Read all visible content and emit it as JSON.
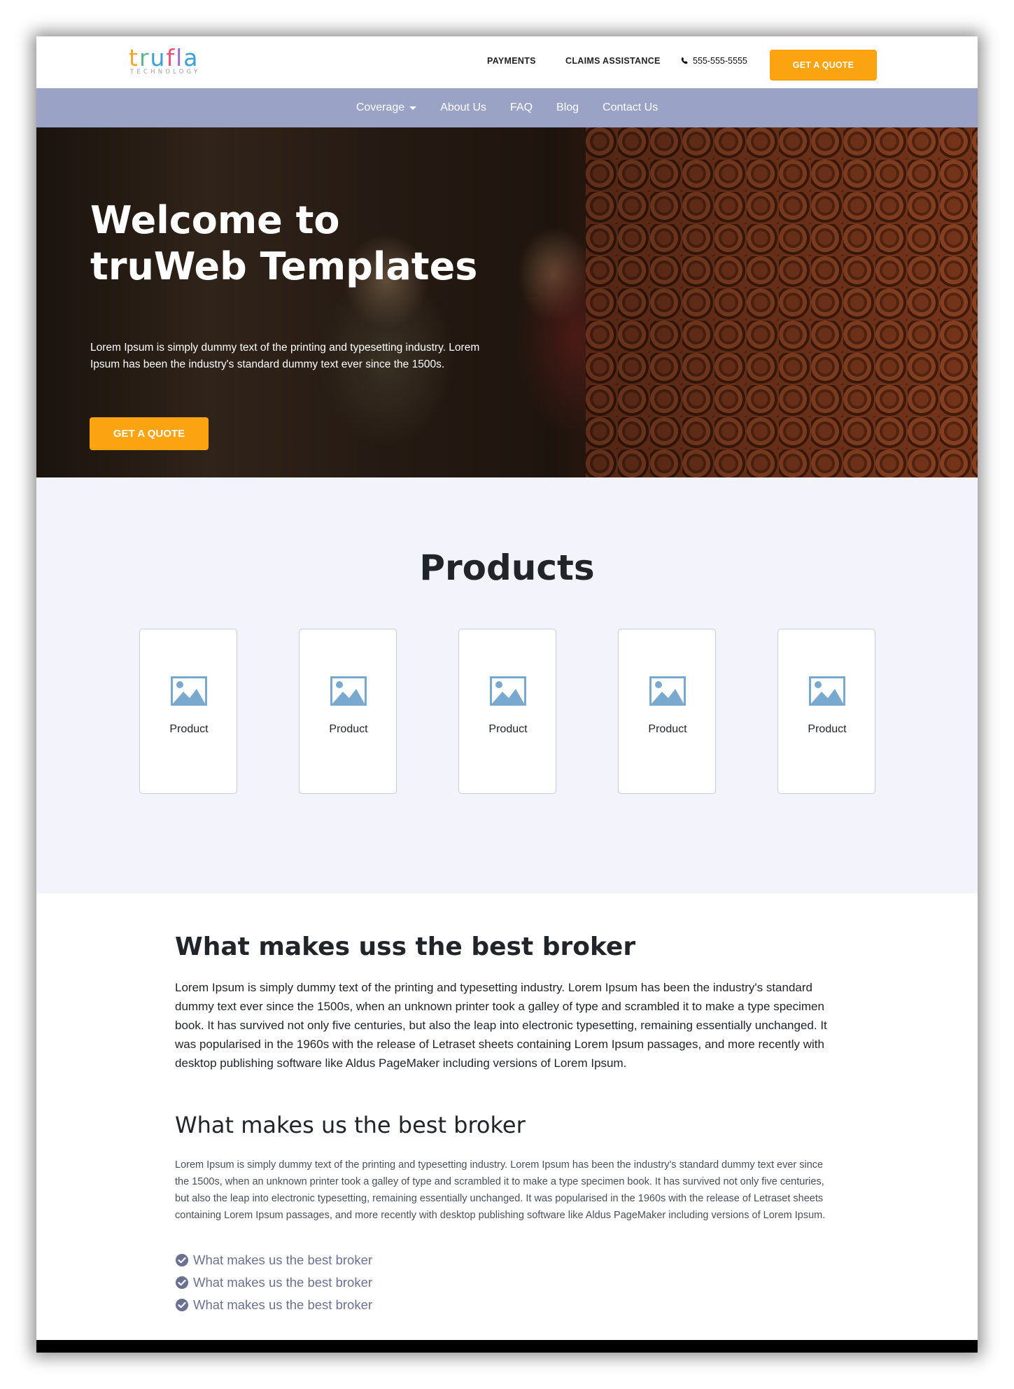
{
  "header": {
    "logo_word": [
      "t",
      "r",
      "u",
      "f",
      "l",
      "a"
    ],
    "logo_sub": "TECHNOLOGY",
    "links": [
      "PAYMENTS",
      "CLAIMS ASSISTANCE"
    ],
    "phone": "555-555-5555",
    "quote_button": "GET A QUOTE",
    "accent_color": "#fca311"
  },
  "nav": {
    "items": [
      "Coverage",
      "About Us",
      "FAQ",
      "Blog",
      "Contact Us"
    ],
    "background": "#9aa3c6"
  },
  "hero": {
    "title": "Welcome to truWeb Templates",
    "text": "Lorem Ipsum is simply dummy text of the printing and typesetting industry. Lorem Ipsum has been the industry's standard dummy text ever since the 1500s.",
    "button": "GET A QUOTE"
  },
  "products": {
    "title": "Products",
    "items": [
      "Product",
      "Product",
      "Product",
      "Product",
      "Product"
    ],
    "icon": "image-placeholder-icon"
  },
  "about": {
    "title": "What makes uss the best broker",
    "lead": "Lorem Ipsum is simply dummy text of the printing and typesetting industry. Lorem Ipsum has been the industry's standard dummy text ever since the 1500s, when an unknown printer took a galley of type and scrambled it to make a type specimen book. It has survived not only five centuries, but also the leap into electronic typesetting, remaining essentially unchanged. It was popularised in the 1960s with the release of Letraset sheets containing Lorem Ipsum passages, and more recently with desktop publishing software like Aldus PageMaker including versions of Lorem Ipsum.",
    "subtitle": "What makes us the best broker",
    "body": "Lorem Ipsum is simply dummy text of the printing and typesetting industry. Lorem Ipsum has been the industry's standard dummy text ever since the 1500s, when an unknown printer took a galley of type and scrambled it to make a type specimen book. It has survived not only five centuries, but also the leap into electronic typesetting, remaining essentially unchanged. It was popularised in the 1960s with the release of Letraset sheets containing Lorem Ipsum passages, and more recently with desktop publishing software like Aldus PageMaker including versions of Lorem Ipsum.",
    "checklist": [
      "What makes us the best broker",
      "What makes us the best broker",
      "What makes us the best broker"
    ],
    "check_color": "#6b7190"
  }
}
